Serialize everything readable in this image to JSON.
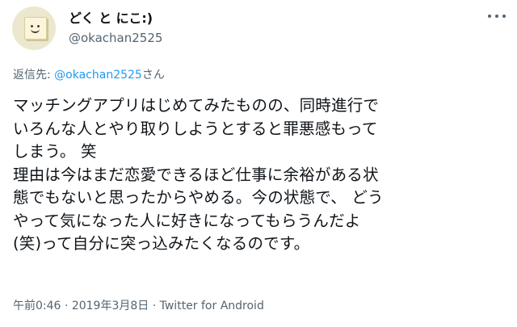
{
  "user": {
    "display_name": "どく と にこ:)",
    "handle": "@okachan2525"
  },
  "reply": {
    "prefix": "返信先: ",
    "mention": "@okachan2525",
    "suffix": "さん"
  },
  "tweet": {
    "text": "マッチングアプリはじめてみたものの、同時進行で\nいろんな人とやり取りしようとすると罪悪感もって\nしまう。 笑\n理由は今はまだ恋愛できるほど仕事に余裕がある状\n態でもないと思ったからやめる。今の状態で、 どう\nやって気になった人に好きになってもらうんだよ\n(笑)って自分に突っ込みたくなるのです。"
  },
  "meta": {
    "time": "午前0:46",
    "sep1": " · ",
    "date": "2019年3月8日",
    "sep2": " · ",
    "source": "Twitter for Android"
  },
  "icons": {
    "avatar": "smiley-note-avatar",
    "more": "more-horizontal-icon"
  }
}
